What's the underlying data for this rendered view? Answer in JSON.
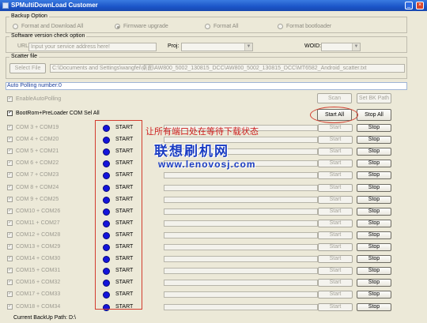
{
  "window": {
    "title": "SPMultiDownLoad Customer",
    "min_label": "_",
    "close_label": "×"
  },
  "backup": {
    "title": "Backup Option",
    "options": [
      "Format and Download All",
      "Firmware upgrade",
      "Format All",
      "Format bootloader"
    ],
    "selected": "Firmware upgrade"
  },
  "version_check": {
    "title": "Software version check option",
    "url_label": "URL:",
    "url_placeholder": "Input your service address here!",
    "proj_label": "Proj:",
    "woid_label": "WOID:"
  },
  "scatter": {
    "title": "Scatter file",
    "select_label": "Select File",
    "path": "C:\\Documents and Settings\\wangfei\\桌面\\AW800_5002_130815_DCC\\AW800_5002_130815_DCC\\MT6582_Android_scatter.txt"
  },
  "polling": {
    "status": "Auto Polling number:0",
    "enable_label": "EnableAutoPolling",
    "scan_label": "Scan",
    "setbk_label": "Set BK Path"
  },
  "controls": {
    "bootrom_label": "BootRom+PreLoader COM Sel All",
    "start_all_label": "Start All",
    "stop_all_label": "Stop All"
  },
  "ports": [
    {
      "label": "COM 3 + COM19",
      "state": "START",
      "start": "Start",
      "stop": "Stop"
    },
    {
      "label": "COM 4 + COM20",
      "state": "START",
      "start": "Start",
      "stop": "Stop"
    },
    {
      "label": "COM 5 + COM21",
      "state": "START",
      "start": "Start",
      "stop": "Stop"
    },
    {
      "label": "COM 6 + COM22",
      "state": "START",
      "start": "Start",
      "stop": "Stop"
    },
    {
      "label": "COM 7 + COM23",
      "state": "START",
      "start": "Start",
      "stop": "Stop"
    },
    {
      "label": "COM 8 + COM24",
      "state": "START",
      "start": "Start",
      "stop": "Stop"
    },
    {
      "label": "COM 9 + COM25",
      "state": "START",
      "start": "Start",
      "stop": "Stop"
    },
    {
      "label": "COM10 + COM26",
      "state": "START",
      "start": "Start",
      "stop": "Stop"
    },
    {
      "label": "COM11 + COM27",
      "state": "START",
      "start": "Start",
      "stop": "Stop"
    },
    {
      "label": "COM12 + COM28",
      "state": "START",
      "start": "Start",
      "stop": "Stop"
    },
    {
      "label": "COM13 + COM29",
      "state": "START",
      "start": "Start",
      "stop": "Stop"
    },
    {
      "label": "COM14 + COM30",
      "state": "START",
      "start": "Start",
      "stop": "Stop"
    },
    {
      "label": "COM15 + COM31",
      "state": "START",
      "start": "Start",
      "stop": "Stop"
    },
    {
      "label": "COM16 + COM32",
      "state": "START",
      "start": "Start",
      "stop": "Stop"
    },
    {
      "label": "COM17 + COM33",
      "state": "START",
      "start": "Start",
      "stop": "Stop"
    },
    {
      "label": "COM18 + COM34",
      "state": "START",
      "start": "Start",
      "stop": "Stop"
    }
  ],
  "annotation": {
    "text": "让所有端口处在等待下载状态",
    "watermark_cn": "联想刷机网",
    "watermark_url": "www.lenovosj.com"
  },
  "status": {
    "backup_path": "Current BackUp Path:  D:\\"
  },
  "colors": {
    "titlebar": "#1b55c8",
    "port_indicator": "#1414dc",
    "annotation_red": "#cc1f1f",
    "watermark_blue": "#1a3cc2"
  }
}
